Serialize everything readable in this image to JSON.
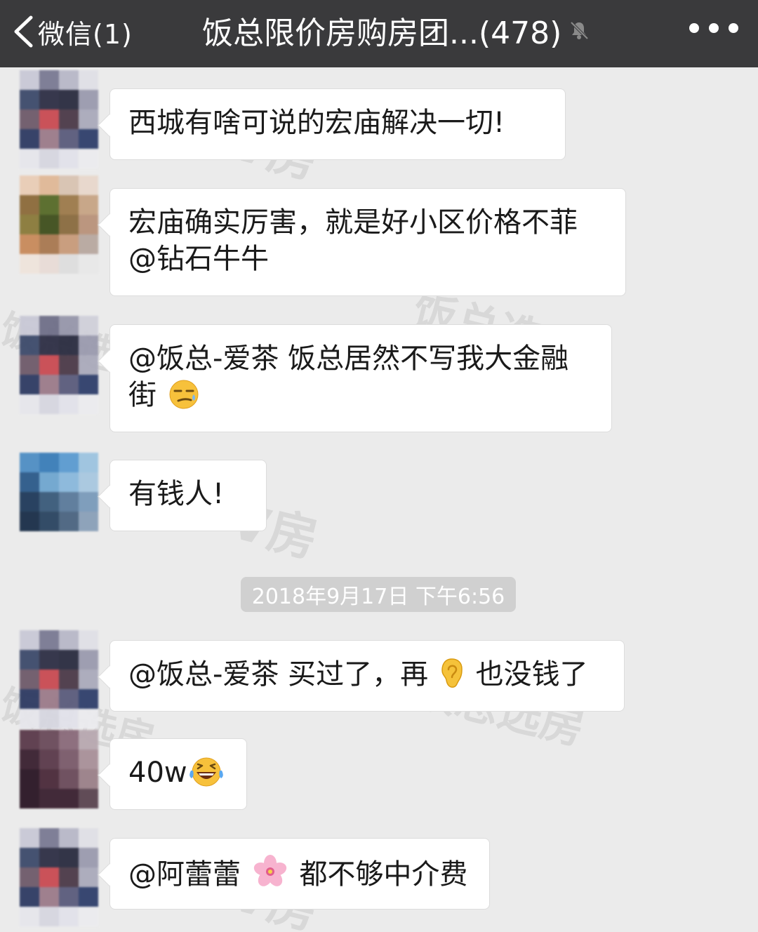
{
  "navbar": {
    "back_label": "微信(1)",
    "title": "饭总限价房购房团...(478)",
    "mute_icon": "bell-mute-icon",
    "more_icon": "more-dots-icon"
  },
  "watermarks": [
    "V房",
    "饭总选房"
  ],
  "timestamp": "2018年9月17日 下午6:56",
  "messages": [
    {
      "lines": [
        "西城有啥可说的宏庙解决一切!"
      ]
    },
    {
      "lines": [
        "宏庙确实厉害，就是好小区价格不菲",
        "@钻石牛牛"
      ]
    },
    {
      "lines": [
        "@饭总-爱茶 饭总居然不写我大金融",
        "街"
      ],
      "emoji": "smirk-emoji"
    },
    {
      "lines": [
        "有钱人!"
      ]
    },
    {
      "parts": [
        "@饭总-爱茶 买过了，再",
        "也没钱了"
      ],
      "emoji": "ear-emoji"
    },
    {
      "parts": [
        "40w"
      ],
      "emoji": "laughing-tears-emoji"
    },
    {
      "parts": [
        "@阿蕾蕾",
        " 都不够中介费"
      ],
      "emoji": "cherry-blossom-emoji"
    }
  ]
}
